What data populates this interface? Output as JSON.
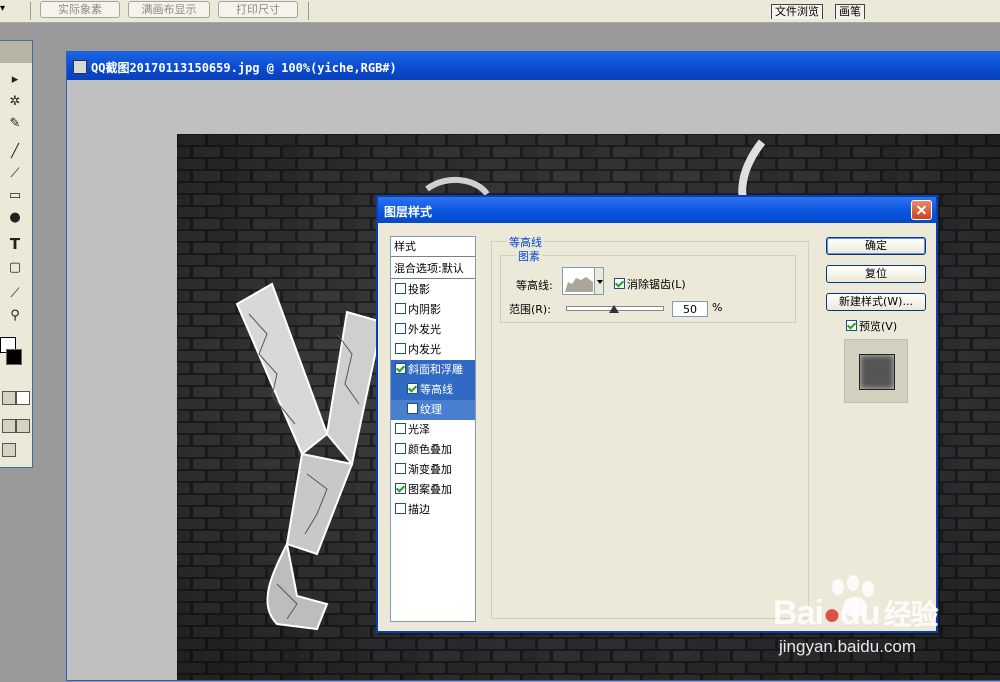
{
  "options_bar": {
    "dropdown_glyph": "▾",
    "buttons": [
      "实际象素",
      "满画布显示",
      "打印尺寸"
    ],
    "palette_tabs": [
      "文件浏览",
      "画笔"
    ]
  },
  "toolbox": {
    "tools": [
      "move-icon",
      "magic-wand-icon",
      "healing-brush-icon",
      "brush-icon",
      "history-brush-icon",
      "gradient-icon",
      "dodge-icon",
      "type-icon",
      "shape-icon",
      "eyedropper-icon",
      "zoom-icon"
    ],
    "type_tool_glyph": "T"
  },
  "document": {
    "title": "QQ截图20170113150659.jpg @ 100%(yiche,RGB#)"
  },
  "dialog": {
    "title": "图层样式",
    "style_list": {
      "header": "样式",
      "blend_options": "混合选项:默认",
      "items": [
        {
          "label": "投影",
          "checked": false
        },
        {
          "label": "内阴影",
          "checked": false
        },
        {
          "label": "外发光",
          "checked": false
        },
        {
          "label": "内发光",
          "checked": false
        },
        {
          "label": "斜面和浮雕",
          "checked": true
        },
        {
          "label": "等高线",
          "checked": true
        },
        {
          "label": "纹理",
          "checked": false
        },
        {
          "label": "光泽",
          "checked": false
        },
        {
          "label": "颜色叠加",
          "checked": false
        },
        {
          "label": "渐变叠加",
          "checked": false
        },
        {
          "label": "图案叠加",
          "checked": true
        },
        {
          "label": "描边",
          "checked": false
        }
      ]
    },
    "panel": {
      "group_title": "等高线",
      "subgroup_title": "图素",
      "contour_label": "等高线:",
      "antialias_label": "消除锯齿(L)",
      "antialias_checked": true,
      "range_label": "范围(R):",
      "range_value": "50",
      "range_unit": "%"
    },
    "buttons": {
      "ok": "确定",
      "reset": "复位",
      "new_style": "新建样式(W)...",
      "preview_label": "预览(V)",
      "preview_checked": true
    }
  },
  "watermark": {
    "brand_left": "Bai",
    "brand_right": "du",
    "brand_cn": "经验",
    "url": "jingyan.baidu.com"
  }
}
